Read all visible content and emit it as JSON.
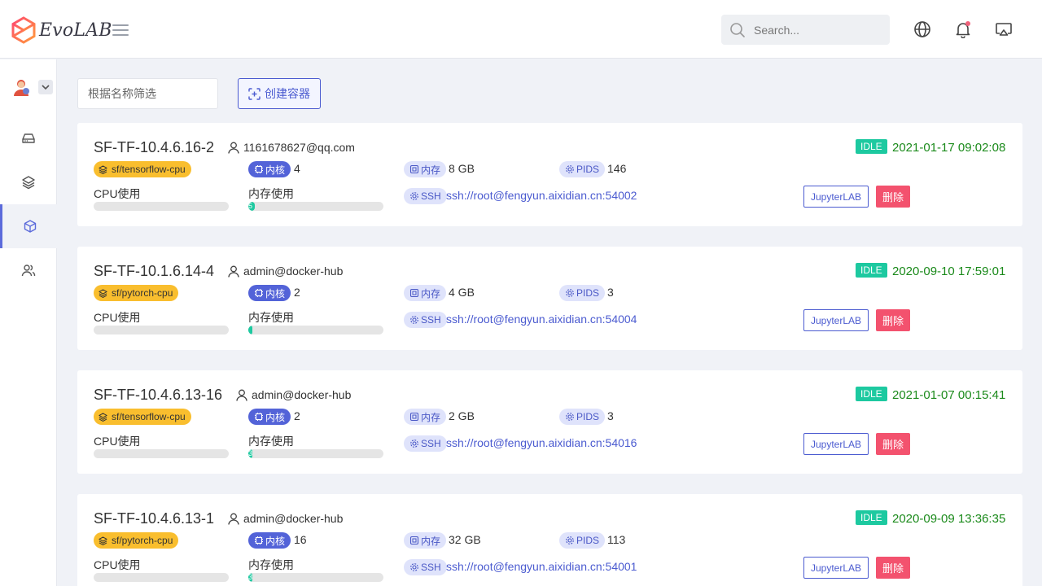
{
  "app": {
    "title": "EvoLAB"
  },
  "search": {
    "placeholder": "Search..."
  },
  "toolbar": {
    "filter_placeholder": "根据名称筛选",
    "create_label": "创建容器"
  },
  "labels": {
    "cpu_cores": "内核",
    "memory": "内存",
    "pids": "PIDS",
    "ssh": "SSH",
    "cpu_usage": "CPU使用",
    "mem_usage": "内存使用",
    "jupyter": "JupyterLAB",
    "delete": "删除"
  },
  "colors": {
    "accent": "#4b5bd0",
    "idle": "#1dc9a0",
    "image_tag": "#f9be2e",
    "delete": "#f3526e",
    "time": "#1b8a1b"
  },
  "containers": [
    {
      "name": "SF-TF-10.4.6.16-2",
      "owner": "1161678627@qq.com",
      "image": "sf/tensorflow-cpu",
      "cores": "4",
      "memory": "8 GB",
      "pids": "146",
      "ssh": "ssh://root@fengyun.aixidian.cn:54002",
      "status": "IDLE",
      "time": "2021-01-17 09:02:08",
      "cpu_usage_pct": 0,
      "mem_usage_pct": 5,
      "mem_usage_text": "5"
    },
    {
      "name": "SF-TF-10.1.6.14-4",
      "owner": "admin@docker-hub",
      "image": "sf/pytorch-cpu",
      "cores": "2",
      "memory": "4 GB",
      "pids": "3",
      "ssh": "ssh://root@fengyun.aixidian.cn:54004",
      "status": "IDLE",
      "time": "2020-09-10 17:59:01",
      "cpu_usage_pct": 0,
      "mem_usage_pct": 1,
      "mem_usage_text": ""
    },
    {
      "name": "SF-TF-10.4.6.13-16",
      "owner": "admin@docker-hub",
      "image": "sf/tensorflow-cpu",
      "cores": "2",
      "memory": "2 GB",
      "pids": "3",
      "ssh": "ssh://root@fengyun.aixidian.cn:54016",
      "status": "IDLE",
      "time": "2021-01-07 00:15:41",
      "cpu_usage_pct": 0,
      "mem_usage_pct": 3,
      "mem_usage_text": "3"
    },
    {
      "name": "SF-TF-10.4.6.13-1",
      "owner": "admin@docker-hub",
      "image": "sf/pytorch-cpu",
      "cores": "16",
      "memory": "32 GB",
      "pids": "113",
      "ssh": "ssh://root@fengyun.aixidian.cn:54001",
      "status": "IDLE",
      "time": "2020-09-09 13:36:35",
      "cpu_usage_pct": 0,
      "mem_usage_pct": 3,
      "mem_usage_text": "3"
    }
  ]
}
